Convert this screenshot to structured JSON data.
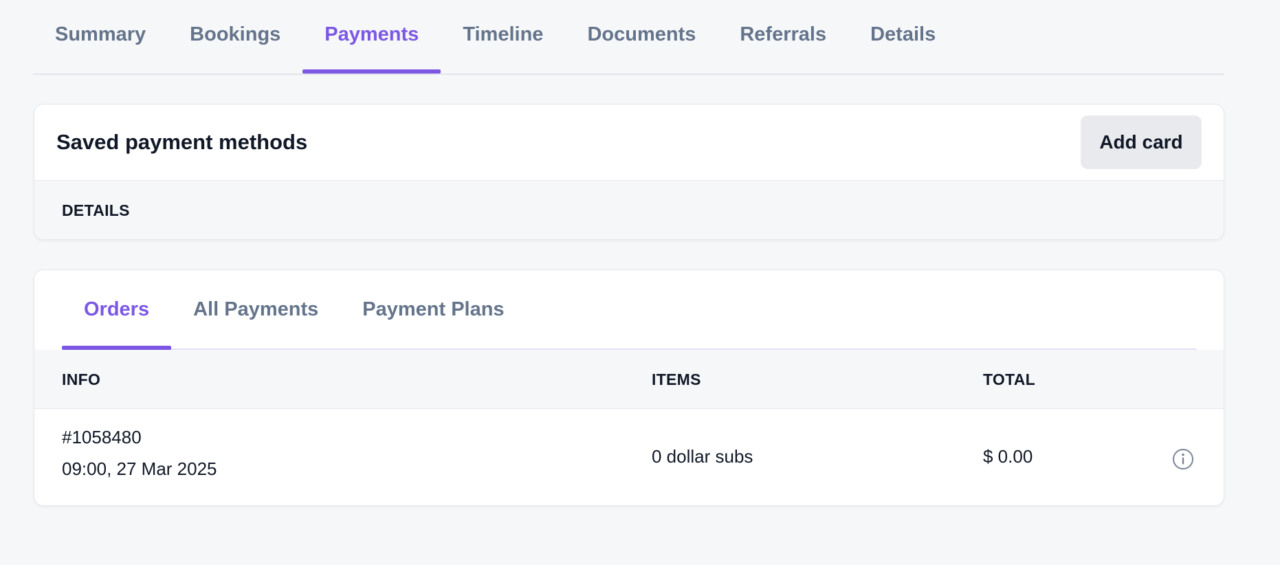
{
  "top_tabs": [
    {
      "label": "Summary",
      "active": false
    },
    {
      "label": "Bookings",
      "active": false
    },
    {
      "label": "Payments",
      "active": true
    },
    {
      "label": "Timeline",
      "active": false
    },
    {
      "label": "Documents",
      "active": false
    },
    {
      "label": "Referrals",
      "active": false
    },
    {
      "label": "Details",
      "active": false
    }
  ],
  "saved_methods": {
    "title": "Saved payment methods",
    "add_card_label": "Add card",
    "details_header": "DETAILS"
  },
  "orders_panel": {
    "tabs": [
      {
        "label": "Orders",
        "active": true
      },
      {
        "label": "All Payments",
        "active": false
      },
      {
        "label": "Payment Plans",
        "active": false
      }
    ],
    "columns": {
      "info": "INFO",
      "items": "ITEMS",
      "total": "TOTAL"
    },
    "rows": [
      {
        "order_id": "#1058480",
        "date": "09:00, 27 Mar 2025",
        "items": "0 dollar subs",
        "total": "$ 0.00",
        "action_icon": "info-circle-icon"
      }
    ]
  },
  "colors": {
    "accent": "#7b57e4",
    "muted_text": "#64748b",
    "background": "#f6f7f9",
    "button_bg": "#e9eaed"
  }
}
